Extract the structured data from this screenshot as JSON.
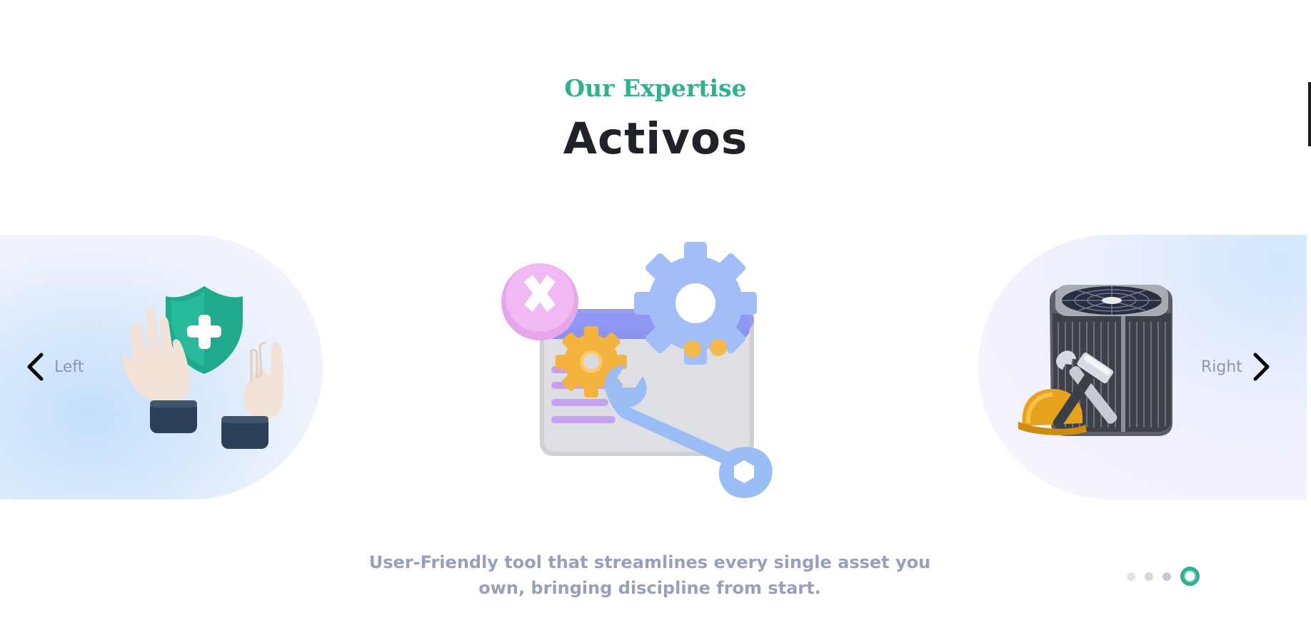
{
  "section": {
    "eyebrow": "Our Expertise",
    "title": "Activos",
    "caption_line1": "User-Friendly tool that streamlines every single asset you",
    "caption_line2": "own, bringing discipline from start."
  },
  "carousel": {
    "prev_label": "Left",
    "next_label": "Right",
    "prev_icon": "chevron-left-icon",
    "next_icon": "chevron-right-icon",
    "slides": [
      {
        "icon": "protection-hands-shield-icon"
      },
      {
        "icon": "settings-tools-icon"
      },
      {
        "icon": "air-conditioner-maintenance-icon"
      }
    ],
    "pagination": {
      "total": 4,
      "active_index": 3
    }
  },
  "colors": {
    "accent": "#2fb08f",
    "title": "#20222a",
    "caption": "#98a0bd",
    "nav_label": "#8d95b3"
  }
}
